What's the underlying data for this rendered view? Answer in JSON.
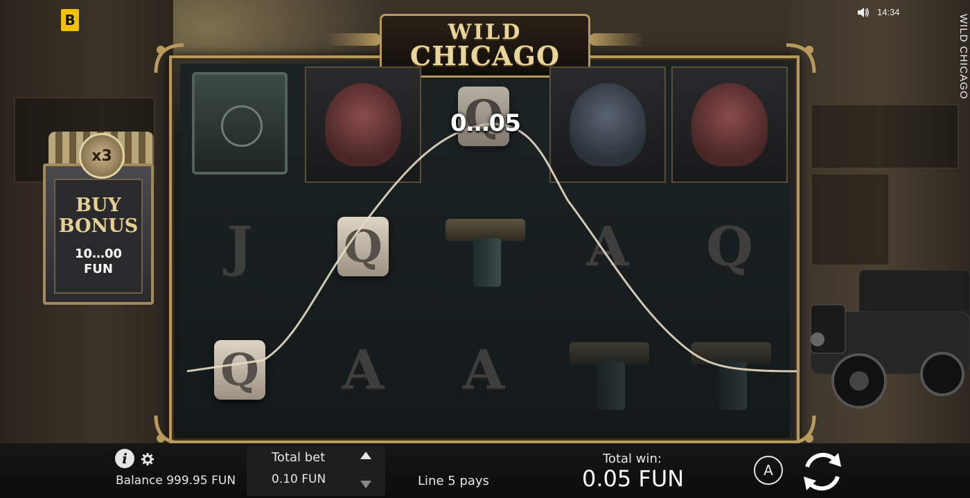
{
  "top_bar": {
    "brand_letter": "B",
    "clock": "14:34",
    "sound_icon": "speaker-icon",
    "side_title": "WILD CHICAGO"
  },
  "game": {
    "title_line1": "WILD",
    "title_line2": "CHICAGO",
    "win_amount_popup": "0…05",
    "reels": [
      [
        "safe",
        "J",
        "Q"
      ],
      [
        "pig-boss",
        "Q",
        "A"
      ],
      [
        "Q",
        "gun",
        "A"
      ],
      [
        "lion-boss",
        "A",
        "gun"
      ],
      [
        "pig-boss",
        "Q",
        "gun"
      ]
    ],
    "highlighted_line": "Line 5"
  },
  "buy_bonus": {
    "multiplier": "x3",
    "line1": "BUY",
    "line2": "BONUS",
    "price": "10…00",
    "currency": "FUN"
  },
  "bottom_bar": {
    "balance": "Balance 999.95 FUN",
    "total_bet_label": "Total bet",
    "total_bet_value": "0.10 FUN",
    "line_pays": "Line 5 pays",
    "total_win_label": "Total win:",
    "total_win_value": "0.05 FUN",
    "auto_label": "A"
  },
  "colors": {
    "accent_gold": "#b89a5e",
    "brand_yellow": "#f2c200",
    "bar_bg": "#0c0c0c"
  }
}
